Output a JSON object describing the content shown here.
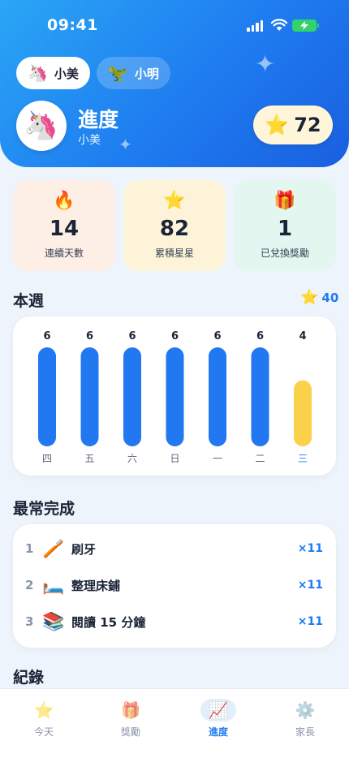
{
  "status_bar": {
    "time": "09:41"
  },
  "profiles": [
    {
      "emoji": "🦄",
      "name": "小美",
      "active": true
    },
    {
      "emoji": "🦖",
      "name": "小明",
      "active": false
    }
  ],
  "header": {
    "avatar_emoji": "🦄",
    "title": "進度",
    "subtitle": "小美",
    "star_emoji": "⭐",
    "stars": "72"
  },
  "stats": [
    {
      "emoji": "🔥",
      "value": "14",
      "label": "連續天數"
    },
    {
      "emoji": "⭐",
      "value": "82",
      "label": "累積星星"
    },
    {
      "emoji": "🎁",
      "value": "1",
      "label": "已兌換獎勵"
    }
  ],
  "week": {
    "title": "本週",
    "total_emoji": "⭐",
    "total": "40"
  },
  "chart_data": {
    "type": "bar",
    "categories": [
      "四",
      "五",
      "六",
      "日",
      "一",
      "二",
      "三"
    ],
    "values": [
      6,
      6,
      6,
      6,
      6,
      6,
      4
    ],
    "highlight_index": 6,
    "ylim": [
      0,
      6
    ],
    "colors": {
      "default": "#2178f0",
      "highlight": "#fbd14b",
      "highlight_label": "#1e7cf0"
    }
  },
  "top_tasks": {
    "title": "最常完成",
    "items": [
      {
        "rank": "1",
        "emoji": "🪥",
        "name": "刷牙",
        "count": "×11"
      },
      {
        "rank": "2",
        "emoji": "🛏️",
        "name": "整理床鋪",
        "count": "×11"
      },
      {
        "rank": "3",
        "emoji": "📚",
        "name": "閱讀 15 分鐘",
        "count": "×11"
      }
    ]
  },
  "records": {
    "title": "紀錄"
  },
  "tabbar": [
    {
      "emoji": "⭐",
      "label": "今天",
      "active": false
    },
    {
      "emoji": "🎁",
      "label": "獎勵",
      "active": false
    },
    {
      "emoji": "📈",
      "label": "進度",
      "active": true
    },
    {
      "emoji": "⚙️",
      "label": "家長",
      "active": false
    }
  ],
  "colors": {
    "accent": "#1e7cf0",
    "hero_start": "#2aa6f5",
    "hero_end": "#1a5fe0"
  }
}
